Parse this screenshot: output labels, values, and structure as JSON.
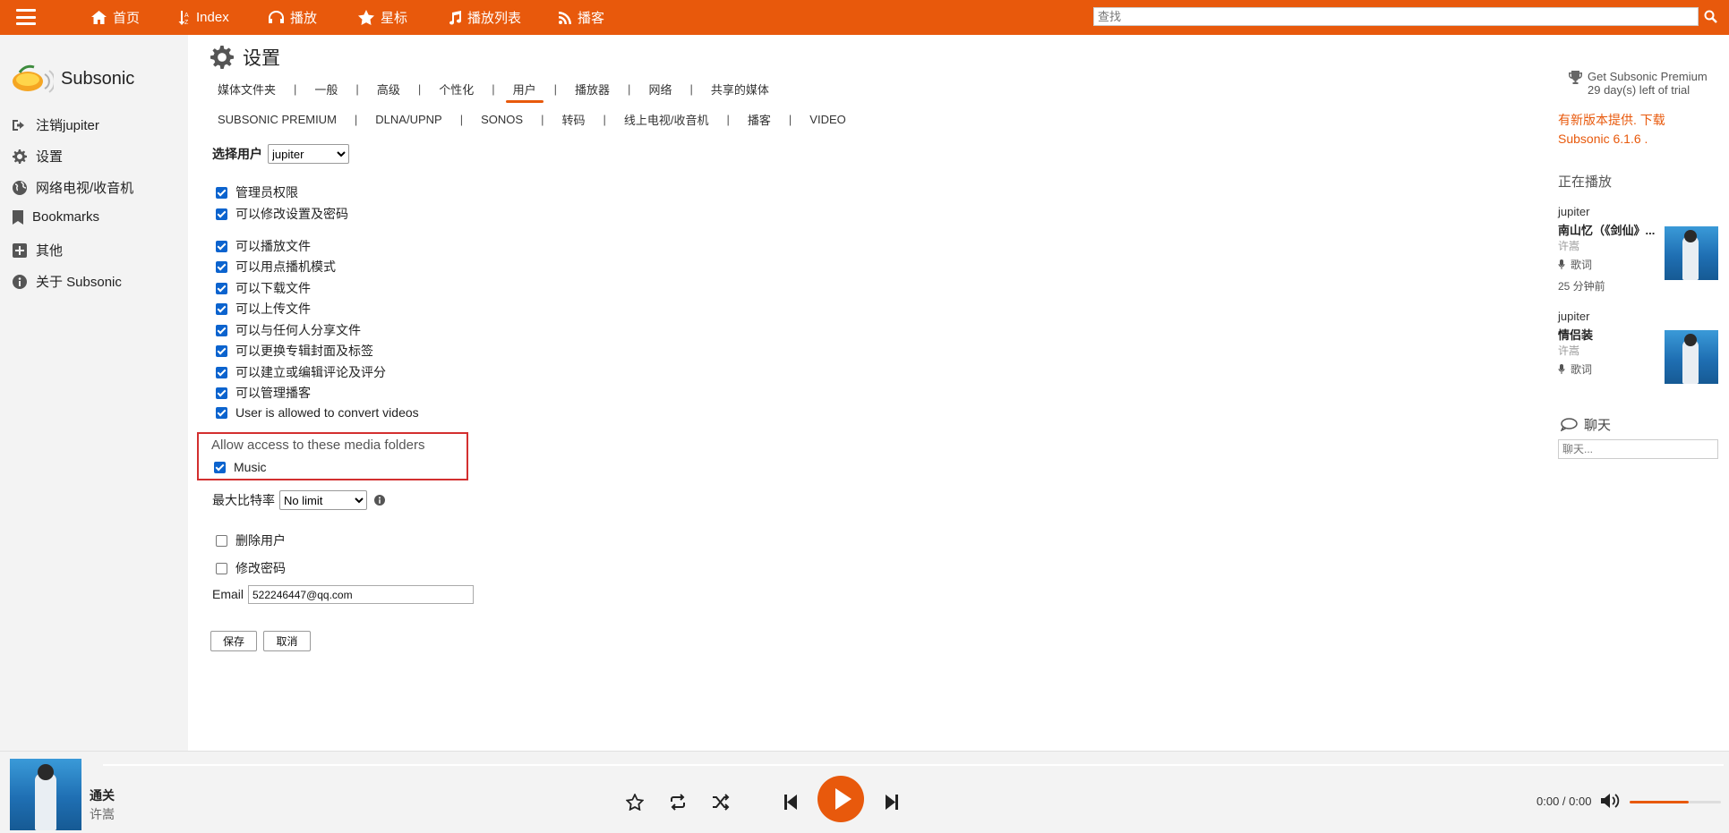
{
  "topbar": {
    "nav": [
      {
        "label": "首页",
        "icon": "home-icon"
      },
      {
        "label": "Index",
        "icon": "sort-alpha-icon"
      },
      {
        "label": "播放",
        "icon": "headphones-icon"
      },
      {
        "label": "星标",
        "icon": "star-icon"
      },
      {
        "label": "播放列表",
        "icon": "music-icon"
      },
      {
        "label": "播客",
        "icon": "rss-icon"
      }
    ],
    "search_placeholder": "查找"
  },
  "sidebar": {
    "brand": "Subsonic",
    "items": [
      {
        "label": "注销jupiter",
        "icon": "logout-icon"
      },
      {
        "label": "设置",
        "icon": "gear-icon"
      },
      {
        "label": "网络电视/收音机",
        "icon": "globe-icon"
      },
      {
        "label": "Bookmarks",
        "icon": "bookmark-icon"
      },
      {
        "label": "其他",
        "icon": "plus-square-icon"
      },
      {
        "label": "关于 Subsonic",
        "icon": "info-icon"
      }
    ]
  },
  "main": {
    "title": "设置",
    "tabs_row1": [
      "媒体文件夹",
      "一般",
      "高级",
      "个性化",
      "用户",
      "播放器",
      "网络",
      "共享的媒体"
    ],
    "tabs_row2": [
      "SUBSONIC PREMIUM",
      "DLNA/UPNP",
      "SONOS",
      "转码",
      "线上电视/收音机",
      "播客",
      "VIDEO"
    ],
    "active_tab": "用户",
    "select_user_label": "选择用户",
    "selected_user": "jupiter",
    "permissions_a": [
      {
        "label": "管理员权限",
        "checked": true
      },
      {
        "label": "可以修改设置及密码",
        "checked": true
      }
    ],
    "permissions_b": [
      {
        "label": "可以播放文件",
        "checked": true
      },
      {
        "label": "可以用点播机模式",
        "checked": true
      },
      {
        "label": "可以下载文件",
        "checked": true
      },
      {
        "label": "可以上传文件",
        "checked": true
      },
      {
        "label": "可以与任何人分享文件",
        "checked": true
      },
      {
        "label": "可以更换专辑封面及标签",
        "checked": true
      },
      {
        "label": "可以建立或编辑评论及评分",
        "checked": true
      },
      {
        "label": "可以管理播客",
        "checked": true
      },
      {
        "label": "User is allowed to convert videos",
        "checked": true
      }
    ],
    "media_folders_title": "Allow access to these media folders",
    "media_folders": [
      {
        "label": "Music",
        "checked": true
      }
    ],
    "bitrate_label": "最大比特率",
    "bitrate_value": "No limit",
    "delete_user_label": "删除用户",
    "change_password_label": "修改密码",
    "email_label": "Email",
    "email_value": "522246447@qq.com",
    "save_label": "保存",
    "cancel_label": "取消"
  },
  "right": {
    "premium_line1": "Get Subsonic Premium",
    "premium_line2": "29 day(s) left of trial",
    "new_version": "有新版本提供. 下载 Subsonic 6.1.6 .",
    "now_playing_title": "正在播放",
    "entries": [
      {
        "user": "jupiter",
        "song": "南山忆（《剑仙》...",
        "artist": "许嵩",
        "lyrics": "歌词",
        "time": "25 分钟前"
      },
      {
        "user": "jupiter",
        "song": "情侣装",
        "artist": "许嵩",
        "lyrics": "歌词",
        "time": ""
      }
    ],
    "chat_title": "聊天",
    "chat_placeholder": "聊天..."
  },
  "player": {
    "song": "通关",
    "artist": "许嵩",
    "time": "0:00 / 0:00",
    "volume": 0.65
  },
  "colors": {
    "accent": "#e8590c",
    "highlight_border": "#d32f2f",
    "checkbox": "#0b63ce"
  }
}
